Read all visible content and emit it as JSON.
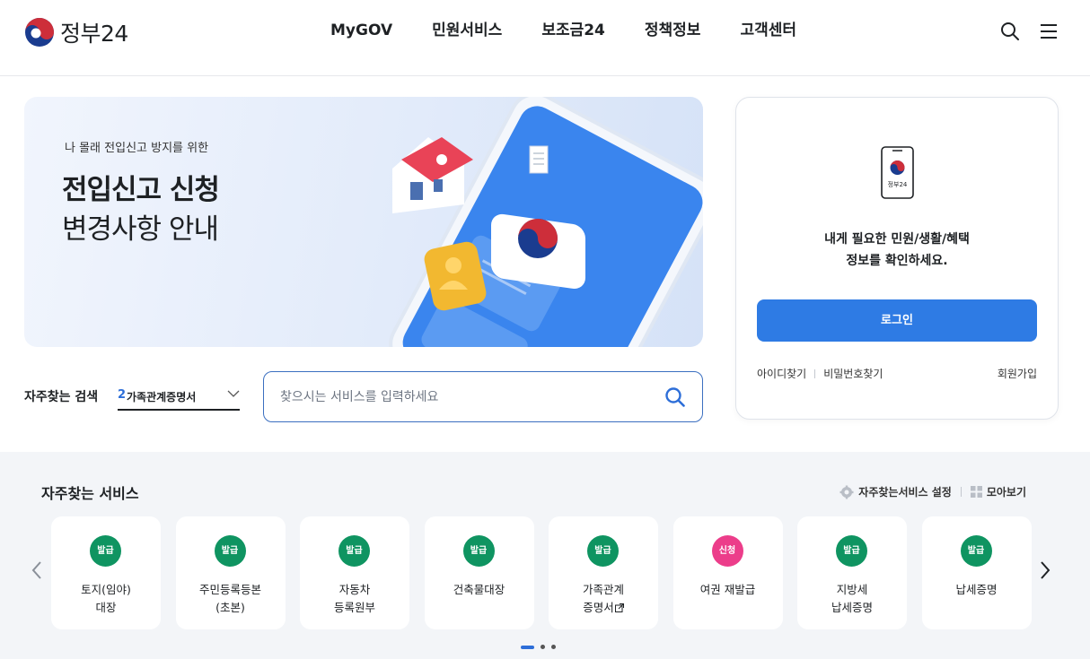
{
  "header": {
    "logo_text": "정부24",
    "nav": [
      "MyGOV",
      "민원서비스",
      "보조금24",
      "정책정보",
      "고객센터"
    ]
  },
  "banner": {
    "subtitle": "나 몰래 전입신고 방지를 위한",
    "title_line1": "전입신고 신청",
    "title_line2": "변경사항 안내"
  },
  "search": {
    "fav_label": "자주찾는 검색",
    "selected_rank": "2",
    "selected_text": "가족관계증명서",
    "placeholder": "찾으시는 서비스를 입력하세요"
  },
  "login": {
    "phone_label": "정부24",
    "message_line1": "내게 필요한 민원/생활/혜택",
    "message_line2": "정보를 확인하세요.",
    "button": "로그인",
    "find_id": "아이디찾기",
    "find_pw": "비밀번호찾기",
    "join": "회원가입"
  },
  "favorites": {
    "title": "자주찾는 서비스",
    "settings": "자주찾는서비스 설정",
    "view_all": "모아보기",
    "items": [
      {
        "badge": "발급",
        "line1": "토지(임야)",
        "line2": "대장"
      },
      {
        "badge": "발급",
        "line1": "주민등록등본",
        "line2": "(초본)"
      },
      {
        "badge": "발급",
        "line1": "자동차",
        "line2": "등록원부"
      },
      {
        "badge": "발급",
        "line1": "건축물대장",
        "line2": ""
      },
      {
        "badge": "발급",
        "line1": "가족관계",
        "line2": "증명서"
      },
      {
        "badge": "신청",
        "line1": "여권 재발급",
        "line2": ""
      },
      {
        "badge": "발급",
        "line1": "지방세",
        "line2": "납세증명"
      },
      {
        "badge": "발급",
        "line1": "납세증명",
        "line2": ""
      }
    ]
  },
  "colors": {
    "primary": "#2e7be4",
    "badge_issue": "#0f9461",
    "badge_apply": "#ec3d8a",
    "banner_bg": "#e2ebfa",
    "section_bg": "#f3f5f8"
  }
}
